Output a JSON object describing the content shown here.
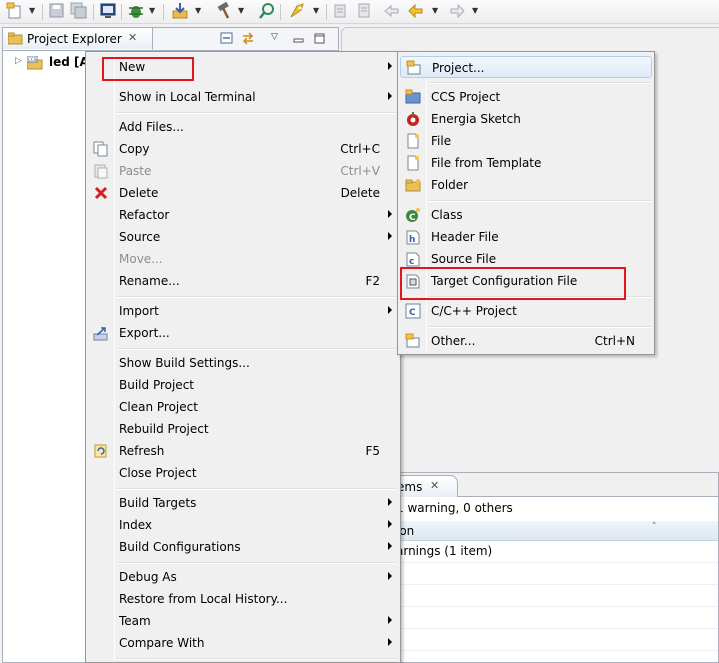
{
  "toolbar": {
    "icons": [
      "new-wizard-icon",
      "save-icon",
      "save-all-icon",
      "terminal-icon",
      "debug-icon",
      "build-icon",
      "hammer-icon",
      "search-icon",
      "flash-icon",
      "prev-annotation-icon",
      "next-annotation-icon",
      "back-icon",
      "forward-icon"
    ]
  },
  "explorer": {
    "tab_label": "Project Explorer",
    "close_glyph": "✕",
    "project_label": "led  [A"
  },
  "problems": {
    "tab_label": "ems",
    "close_glyph": "✕",
    "summary": "1 warning, 0 others",
    "column": "ion",
    "sort_glyph": "˄",
    "rows": [
      "arnings (1 item)"
    ]
  },
  "context_menu": {
    "items": [
      {
        "label": "New",
        "accel": "",
        "submenu": true,
        "icon": ""
      },
      {
        "label": "Show in Local Terminal",
        "accel": "",
        "submenu": true,
        "icon": ""
      },
      {
        "label": "Add Files...",
        "accel": "",
        "submenu": false,
        "icon": ""
      },
      {
        "label": "Copy",
        "accel": "Ctrl+C",
        "submenu": false,
        "icon": "copy-icon"
      },
      {
        "label": "Paste",
        "accel": "Ctrl+V",
        "submenu": false,
        "icon": "paste-icon",
        "disabled": true
      },
      {
        "label": "Delete",
        "accel": "Delete",
        "submenu": false,
        "icon": "delete-icon"
      },
      {
        "label": "Refactor",
        "accel": "",
        "submenu": true,
        "icon": ""
      },
      {
        "label": "Source",
        "accel": "",
        "submenu": true,
        "icon": ""
      },
      {
        "label": "Move...",
        "accel": "",
        "submenu": false,
        "icon": "",
        "disabled": true
      },
      {
        "label": "Rename...",
        "accel": "F2",
        "submenu": false,
        "icon": ""
      },
      {
        "label": "Import",
        "accel": "",
        "submenu": true,
        "icon": ""
      },
      {
        "label": "Export...",
        "accel": "",
        "submenu": false,
        "icon": "export-icon"
      },
      {
        "label": "Show Build Settings...",
        "accel": "",
        "submenu": false,
        "icon": ""
      },
      {
        "label": "Build Project",
        "accel": "",
        "submenu": false,
        "icon": ""
      },
      {
        "label": "Clean Project",
        "accel": "",
        "submenu": false,
        "icon": ""
      },
      {
        "label": "Rebuild Project",
        "accel": "",
        "submenu": false,
        "icon": ""
      },
      {
        "label": "Refresh",
        "accel": "F5",
        "submenu": false,
        "icon": "refresh-icon"
      },
      {
        "label": "Close Project",
        "accel": "",
        "submenu": false,
        "icon": ""
      },
      {
        "label": "Build Targets",
        "accel": "",
        "submenu": true,
        "icon": ""
      },
      {
        "label": "Index",
        "accel": "",
        "submenu": true,
        "icon": ""
      },
      {
        "label": "Build Configurations",
        "accel": "",
        "submenu": true,
        "icon": ""
      },
      {
        "label": "Debug As",
        "accel": "",
        "submenu": true,
        "icon": ""
      },
      {
        "label": "Restore from Local History...",
        "accel": "",
        "submenu": false,
        "icon": ""
      },
      {
        "label": "Team",
        "accel": "",
        "submenu": true,
        "icon": ""
      },
      {
        "label": "Compare With",
        "accel": "",
        "submenu": true,
        "icon": ""
      }
    ]
  },
  "new_submenu": {
    "items": [
      {
        "label": "Project...",
        "accel": "",
        "icon": "new-project-icon"
      },
      {
        "label": "CCS Project",
        "accel": "",
        "icon": "ccs-project-icon"
      },
      {
        "label": "Energia Sketch",
        "accel": "",
        "icon": "energia-sketch-icon"
      },
      {
        "label": "File",
        "accel": "",
        "icon": "file-icon"
      },
      {
        "label": "File from Template",
        "accel": "",
        "icon": "file-template-icon"
      },
      {
        "label": "Folder",
        "accel": "",
        "icon": "folder-icon"
      },
      {
        "label": "Class",
        "accel": "",
        "icon": "class-icon"
      },
      {
        "label": "Header File",
        "accel": "",
        "icon": "header-file-icon"
      },
      {
        "label": "Source File",
        "accel": "",
        "icon": "source-file-icon"
      },
      {
        "label": "Target Configuration File",
        "accel": "",
        "icon": "target-config-icon"
      },
      {
        "label": "C/C++ Project",
        "accel": "",
        "icon": "cpp-project-icon"
      },
      {
        "label": "Other...",
        "accel": "Ctrl+N",
        "icon": "other-wizard-icon"
      }
    ]
  },
  "colors": {
    "highlight_box": "#e0151d",
    "menu_bg": "#f0f0f0",
    "active_item": "#dfeaf8"
  }
}
